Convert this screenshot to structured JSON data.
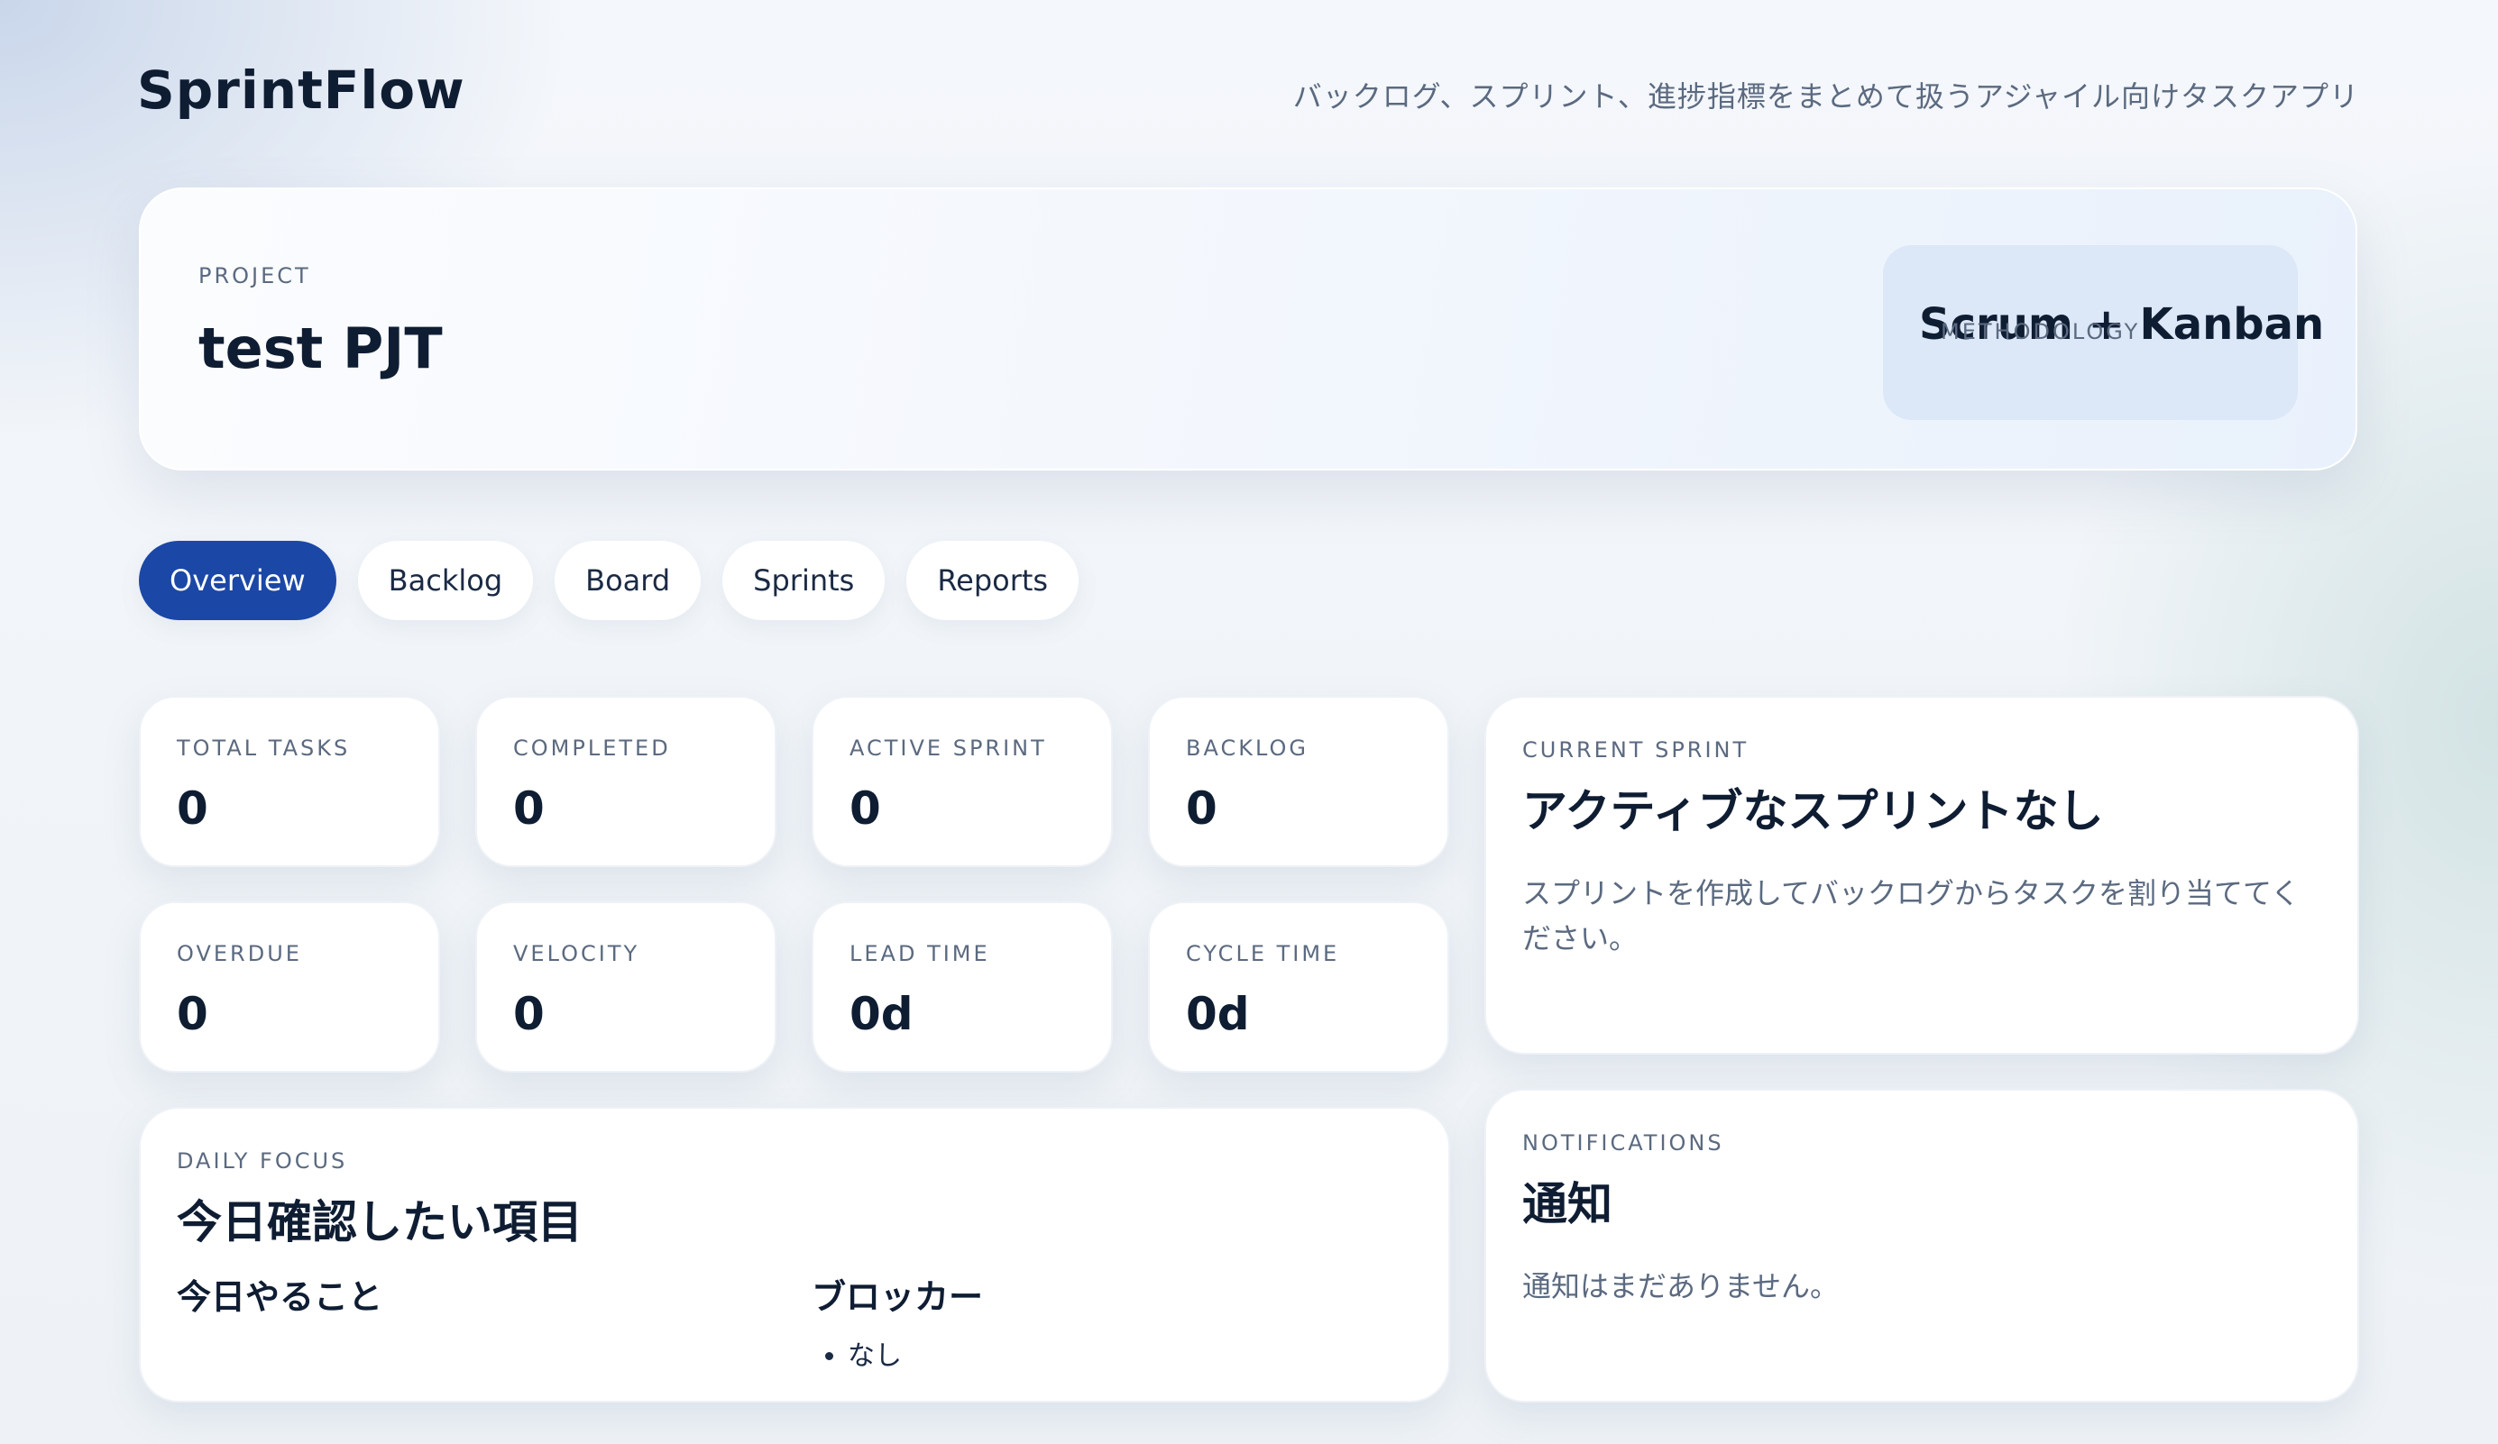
{
  "app": {
    "brand": "SprintFlow",
    "tagline": "バックログ、スプリント、進捗指標をまとめて扱うアジャイル向けタスクアプリ"
  },
  "project": {
    "label": "PROJECT",
    "name": "test PJT",
    "methodology_label": "METHODOLOGY",
    "methodology": "Scrum + Kanban"
  },
  "tabs": [
    {
      "label": "Overview",
      "active": true
    },
    {
      "label": "Backlog",
      "active": false
    },
    {
      "label": "Board",
      "active": false
    },
    {
      "label": "Sprints",
      "active": false
    },
    {
      "label": "Reports",
      "active": false
    }
  ],
  "stats": [
    {
      "label": "TOTAL TASKS",
      "value": "0"
    },
    {
      "label": "COMPLETED",
      "value": "0"
    },
    {
      "label": "ACTIVE SPRINT",
      "value": "0"
    },
    {
      "label": "BACKLOG",
      "value": "0"
    },
    {
      "label": "OVERDUE",
      "value": "0"
    },
    {
      "label": "VELOCITY",
      "value": "0"
    },
    {
      "label": "LEAD TIME",
      "value": "0d"
    },
    {
      "label": "CYCLE TIME",
      "value": "0d"
    }
  ],
  "current_sprint": {
    "label": "CURRENT SPRINT",
    "title": "アクティブなスプリントなし",
    "description": "スプリントを作成してバックログからタスクを割り当ててください。"
  },
  "daily_focus": {
    "label": "DAILY FOCUS",
    "title": "今日確認したい項目",
    "today_heading": "今日やること",
    "blockers_heading": "ブロッカー",
    "blockers": [
      "なし"
    ]
  },
  "notifications": {
    "label": "NOTIFICATIONS",
    "title": "通知",
    "empty_text": "通知はまだありません。"
  },
  "colors": {
    "accent": "#1b47a6",
    "text": "#0f1d33",
    "muted": "#5b6a80"
  }
}
